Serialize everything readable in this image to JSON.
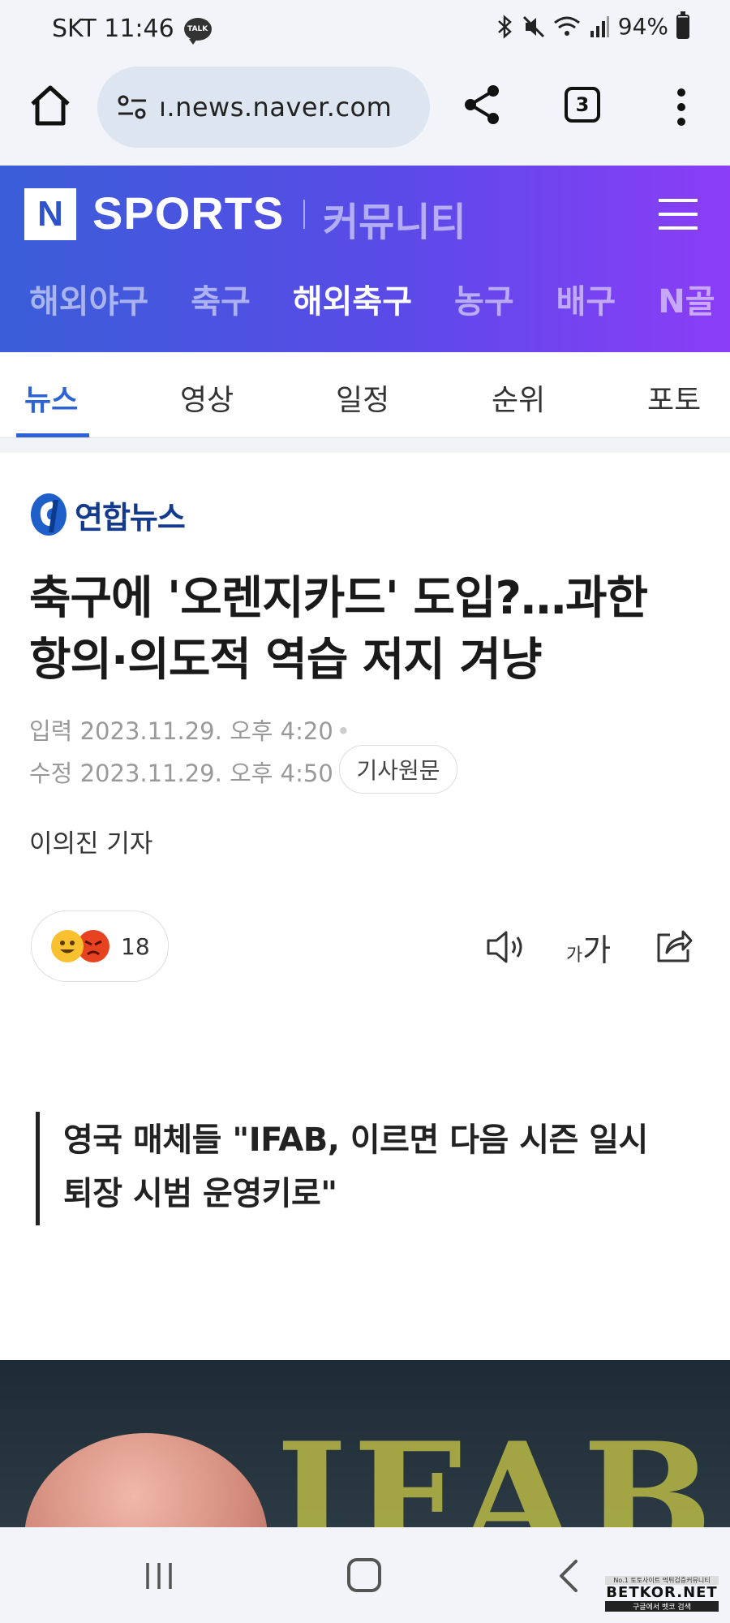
{
  "status_bar": {
    "carrier_time": "SKT 11:46",
    "talk_badge": "TALK",
    "battery": "94%"
  },
  "browser": {
    "url": "ı.news.naver.com",
    "tab_count": "3"
  },
  "sports_header": {
    "logo_letter": "N",
    "logo_text": "SPORTS",
    "community": "커뮤니티",
    "categories": [
      {
        "label": "해외야구"
      },
      {
        "label": "축구"
      },
      {
        "label": "해외축구"
      },
      {
        "label": "농구"
      },
      {
        "label": "배구"
      },
      {
        "label": "N골"
      }
    ],
    "active_category": "해외축구"
  },
  "sub_tabs": [
    {
      "label": "뉴스"
    },
    {
      "label": "영상"
    },
    {
      "label": "일정"
    },
    {
      "label": "순위"
    },
    {
      "label": "포토"
    }
  ],
  "article": {
    "press_name": "연합뉴스",
    "headline": "축구에 '오렌지카드' 도입?…과한 항의·의도적 역습 저지 겨냥",
    "input_label": "입력",
    "input_time": "2023.11.29. 오후 4:20",
    "edit_label": "수정",
    "edit_time": "2023.11.29. 오후 4:50",
    "original_button": "기사원문",
    "reporter": "이의진 기자",
    "reaction_count": "18",
    "fontsize_small": "가",
    "fontsize_large": "가",
    "subtitle": "영국 매체들 \"IFAB, 이르면 다음 시즌 일시 퇴장 시범 운영키로\"",
    "photo_text": "IFAB"
  },
  "watermark": {
    "top": "No.1 토토사이트 먹튀검증커뮤니티",
    "main": "BETKOR.NET",
    "bottom": "구글에서 벳코 검색"
  },
  "colors": {
    "accent_blue": "#2d63d6",
    "header_gradient_start": "#3a5ed8",
    "header_gradient_end": "#8b3df7",
    "press_blue": "#143a8c"
  }
}
